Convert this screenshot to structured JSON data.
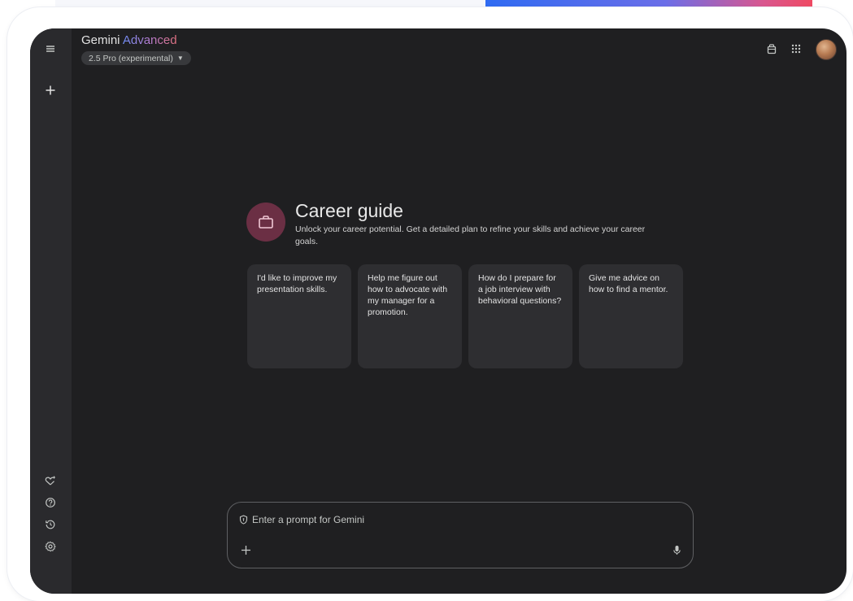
{
  "header": {
    "title_main": "Gemini",
    "title_tier": "Advanced",
    "model_label": "2.5 Pro (experimental)"
  },
  "rail": {
    "top_icons": [
      "menu-icon",
      "new-chat-icon"
    ],
    "bottom_icons": [
      "gem-manager-icon",
      "help-icon",
      "activity-icon",
      "settings-icon"
    ]
  },
  "top_right_icons": [
    "gem-bag-icon",
    "apps-grid-icon",
    "avatar"
  ],
  "gem": {
    "title": "Career guide",
    "description": "Unlock your career potential. Get a detailed plan to refine your skills and achieve your career goals."
  },
  "prompts": [
    "I'd like to improve my presentation skills.",
    "Help me figure out how to advocate with my manager for a promotion.",
    "How do I prepare for a job interview with behavioral questions?",
    "Give me advice on how to find a mentor."
  ],
  "input": {
    "placeholder": "Enter a prompt for Gemini"
  },
  "colors": {
    "screen_bg": "#1f1f21",
    "rail_bg": "#2a2a2d",
    "card_bg": "#2e2e31",
    "gem_badge": "#6b2f44",
    "advanced_gradient": [
      "#6f8cf3",
      "#b77ccf",
      "#e0707c"
    ]
  }
}
